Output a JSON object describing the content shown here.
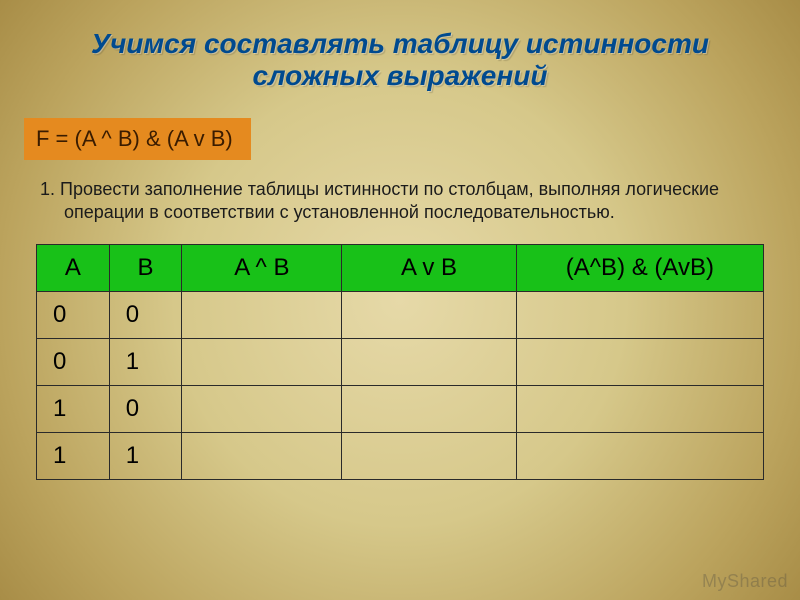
{
  "title_line1": "Учимся составлять таблицу истинности",
  "title_line2": "сложных выражений",
  "formula": "F = (A ^ B) & (A v B)",
  "instruction_num": "1.",
  "instruction_text": "Провести заполнение таблицы истинности по столбцам, выполняя логические операции в соответствии с установленной последовательностью.",
  "headers": {
    "a": "A",
    "b": "B",
    "a_and_b": "A ^ B",
    "a_or_b": "A v B",
    "f": "(A^B) & (AvB)"
  },
  "rows": [
    {
      "a": "0",
      "b": "0",
      "a_and_b": "",
      "a_or_b": "",
      "f": ""
    },
    {
      "a": "0",
      "b": "1",
      "a_and_b": "",
      "a_or_b": "",
      "f": ""
    },
    {
      "a": "1",
      "b": "0",
      "a_and_b": "",
      "a_or_b": "",
      "f": ""
    },
    {
      "a": "1",
      "b": "1",
      "a_and_b": "",
      "a_or_b": "",
      "f": ""
    }
  ],
  "watermark": "MyShared"
}
